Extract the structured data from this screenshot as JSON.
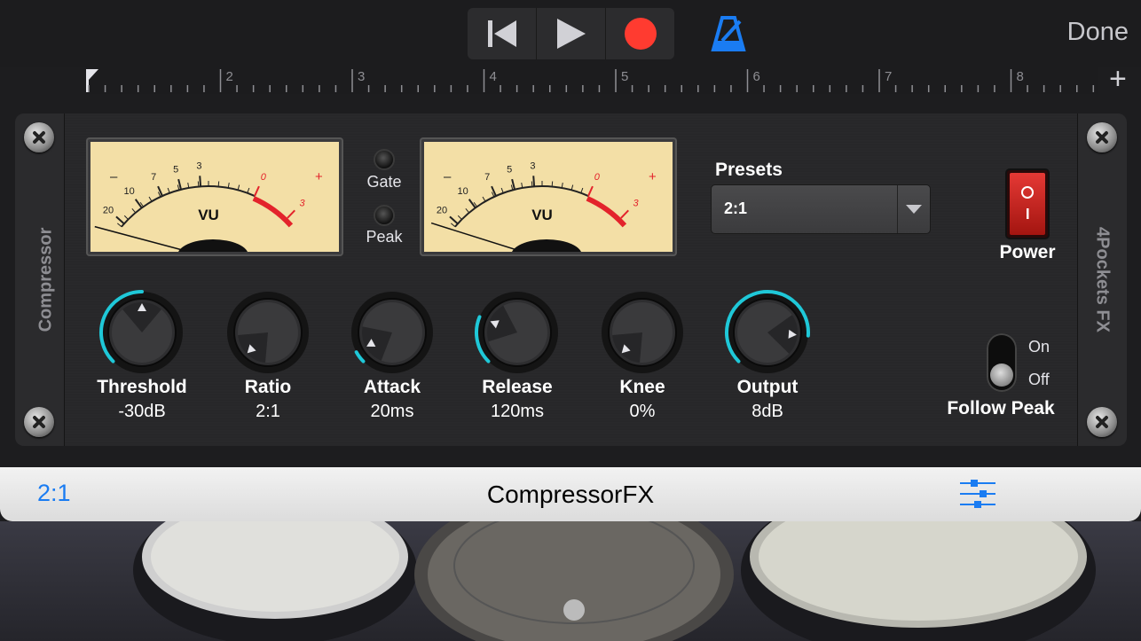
{
  "toolbar": {
    "rewind_icon": "skip-back-icon",
    "play_icon": "play-icon",
    "record_icon": "record-icon",
    "metronome_icon": "metronome-icon",
    "done_label": "Done",
    "record_color": "#ff3b30",
    "metronome_color": "#1a7cf2"
  },
  "ruler": {
    "marks": [
      "2",
      "3",
      "4",
      "5",
      "6",
      "7",
      "8"
    ],
    "add_label": "+"
  },
  "plugin": {
    "left_label": "Compressor",
    "right_label": "4Pockets FX",
    "vu_left_label": "VU",
    "vu_right_label": "VU",
    "vu_scale": [
      "20",
      "10",
      "7",
      "5",
      "3",
      "0",
      "3"
    ],
    "vu_minus": "–",
    "vu_plus": "+",
    "gate_label": "Gate",
    "peak_label": "Peak",
    "presets_label": "Presets",
    "preset_value": "2:1",
    "power_label": "Power",
    "follow_peak_label": "Follow Peak",
    "on_label": "On",
    "off_label": "Off",
    "follow_peak_state": "Off",
    "knobs": [
      {
        "label": "Threshold",
        "value": "-30dB",
        "level": 0.5
      },
      {
        "label": "Ratio",
        "value": "2:1",
        "level": 0.0
      },
      {
        "label": "Attack",
        "value": "20ms",
        "level": 0.06
      },
      {
        "label": "Release",
        "value": "120ms",
        "level": 0.25
      },
      {
        "label": "Knee",
        "value": "0%",
        "level": 0.0
      },
      {
        "label": "Output",
        "value": "8dB",
        "level": 0.85
      }
    ],
    "accent_color": "#1fc8d8"
  },
  "bottom_bar": {
    "preset_link": "2:1",
    "title": "CompressorFX",
    "mixer_icon": "sliders-icon"
  }
}
